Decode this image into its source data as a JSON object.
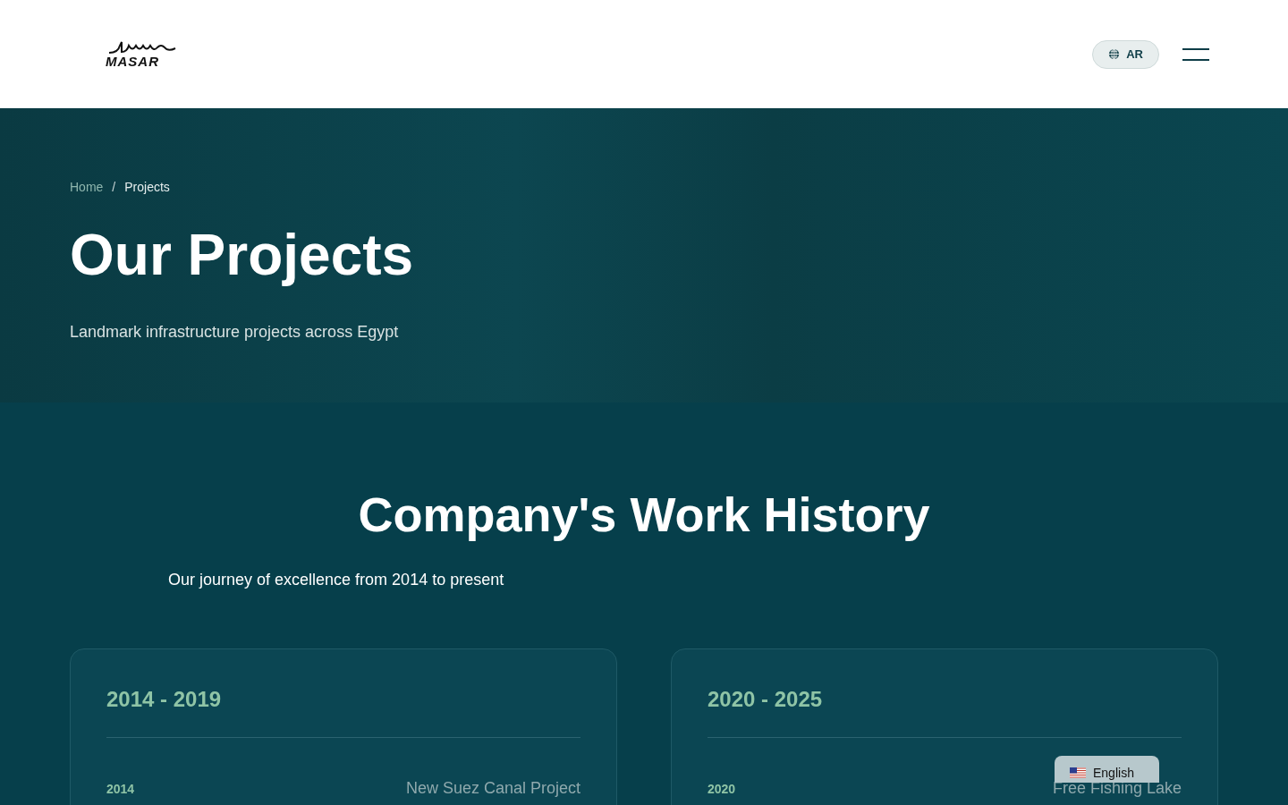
{
  "header": {
    "logo_text": "MASAR",
    "language_button": "AR"
  },
  "hero": {
    "breadcrumb_separator": "/",
    "breadcrumb": [
      {
        "label": "Home",
        "selected": false
      },
      {
        "label": "Projects",
        "selected": true
      }
    ],
    "title": "Our Projects",
    "subtitle": "Landmark infrastructure projects across Egypt"
  },
  "history": {
    "title": "Company's Work History",
    "subtitle": "Our journey of excellence from 2014 to present",
    "periods": [
      {
        "range": "2014 - 2019",
        "entries": [
          {
            "year": "2014",
            "project": "New Suez Canal Project"
          }
        ]
      },
      {
        "range": "2020 - 2025",
        "entries": [
          {
            "year": "2020",
            "project": "Free Fishing Lake"
          }
        ]
      }
    ]
  },
  "language_widget": {
    "label": "English"
  }
}
